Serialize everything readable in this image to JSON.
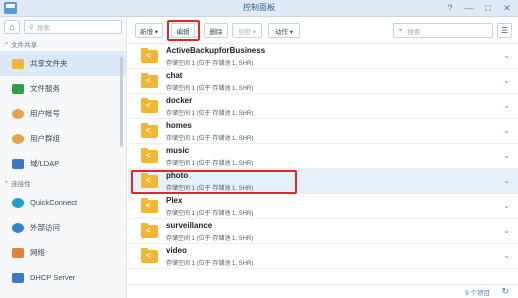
{
  "window": {
    "title": "控制面板",
    "controls": [
      "?",
      "—",
      "□",
      "✕"
    ]
  },
  "sidebar": {
    "search_placeholder": "搜索",
    "sections": {
      "file_sharing": "文件共享",
      "connectivity": "连接性"
    },
    "items": [
      {
        "label": "共享文件夹",
        "icon": "shared-folder-icon",
        "color": "#f2b632",
        "active": true
      },
      {
        "label": "文件服务",
        "icon": "file-services-icon",
        "color": "#2e9e4a"
      },
      {
        "label": "用户帐号",
        "icon": "user-icon",
        "color": "#e6a14a"
      },
      {
        "label": "用户群组",
        "icon": "group-icon",
        "color": "#e6a14a"
      },
      {
        "label": "域/LDAP",
        "icon": "domain-icon",
        "color": "#3b79c6"
      },
      {
        "label": "QuickConnect",
        "icon": "quickconnect-icon",
        "color": "#1fa0c8"
      },
      {
        "label": "外部访问",
        "icon": "globe-icon",
        "color": "#2f83cf"
      },
      {
        "label": "网络",
        "icon": "network-icon",
        "color": "#e0833a"
      },
      {
        "label": "DHCP Server",
        "icon": "dhcp-icon",
        "color": "#3b79c6"
      }
    ]
  },
  "toolbar": {
    "create": "新增 ▾",
    "edit": "编辑",
    "delete": "删除",
    "encrypt": "加密 ▾",
    "action": "动作 ▾",
    "filter_placeholder": "搜索"
  },
  "shares": [
    {
      "name": "ActiveBackupforBusiness",
      "desc": "存储空间 1 (位于 存储池 1, SHR)"
    },
    {
      "name": "chat",
      "desc": "存储空间 1 (位于 存储池 1, SHR)"
    },
    {
      "name": "docker",
      "desc": "存储空间 1 (位于 存储池 1, SHR)"
    },
    {
      "name": "homes",
      "desc": "存储空间 1 (位于 存储池 1, SHR)"
    },
    {
      "name": "music",
      "desc": "存储空间 1 (位于 存储池 1, SHR)"
    },
    {
      "name": "photo",
      "desc": "存储空间 1 (位于 存储池 1, SHR)",
      "selected": true
    },
    {
      "name": "Plex",
      "desc": "存储空间 1 (位于 存储池 1, SHR)"
    },
    {
      "name": "surveillance",
      "desc": "存储空间 1 (位于 存储池 1, SHR)"
    },
    {
      "name": "video",
      "desc": "存储空间 1 (位于 存储池 1, SHR)"
    }
  ],
  "footer": {
    "count": "9 个项目",
    "refresh_icon": "refresh-icon"
  },
  "colors": {
    "highlight": "#e32626",
    "accent": "#4b7fc0",
    "folder": "#f2b632"
  }
}
